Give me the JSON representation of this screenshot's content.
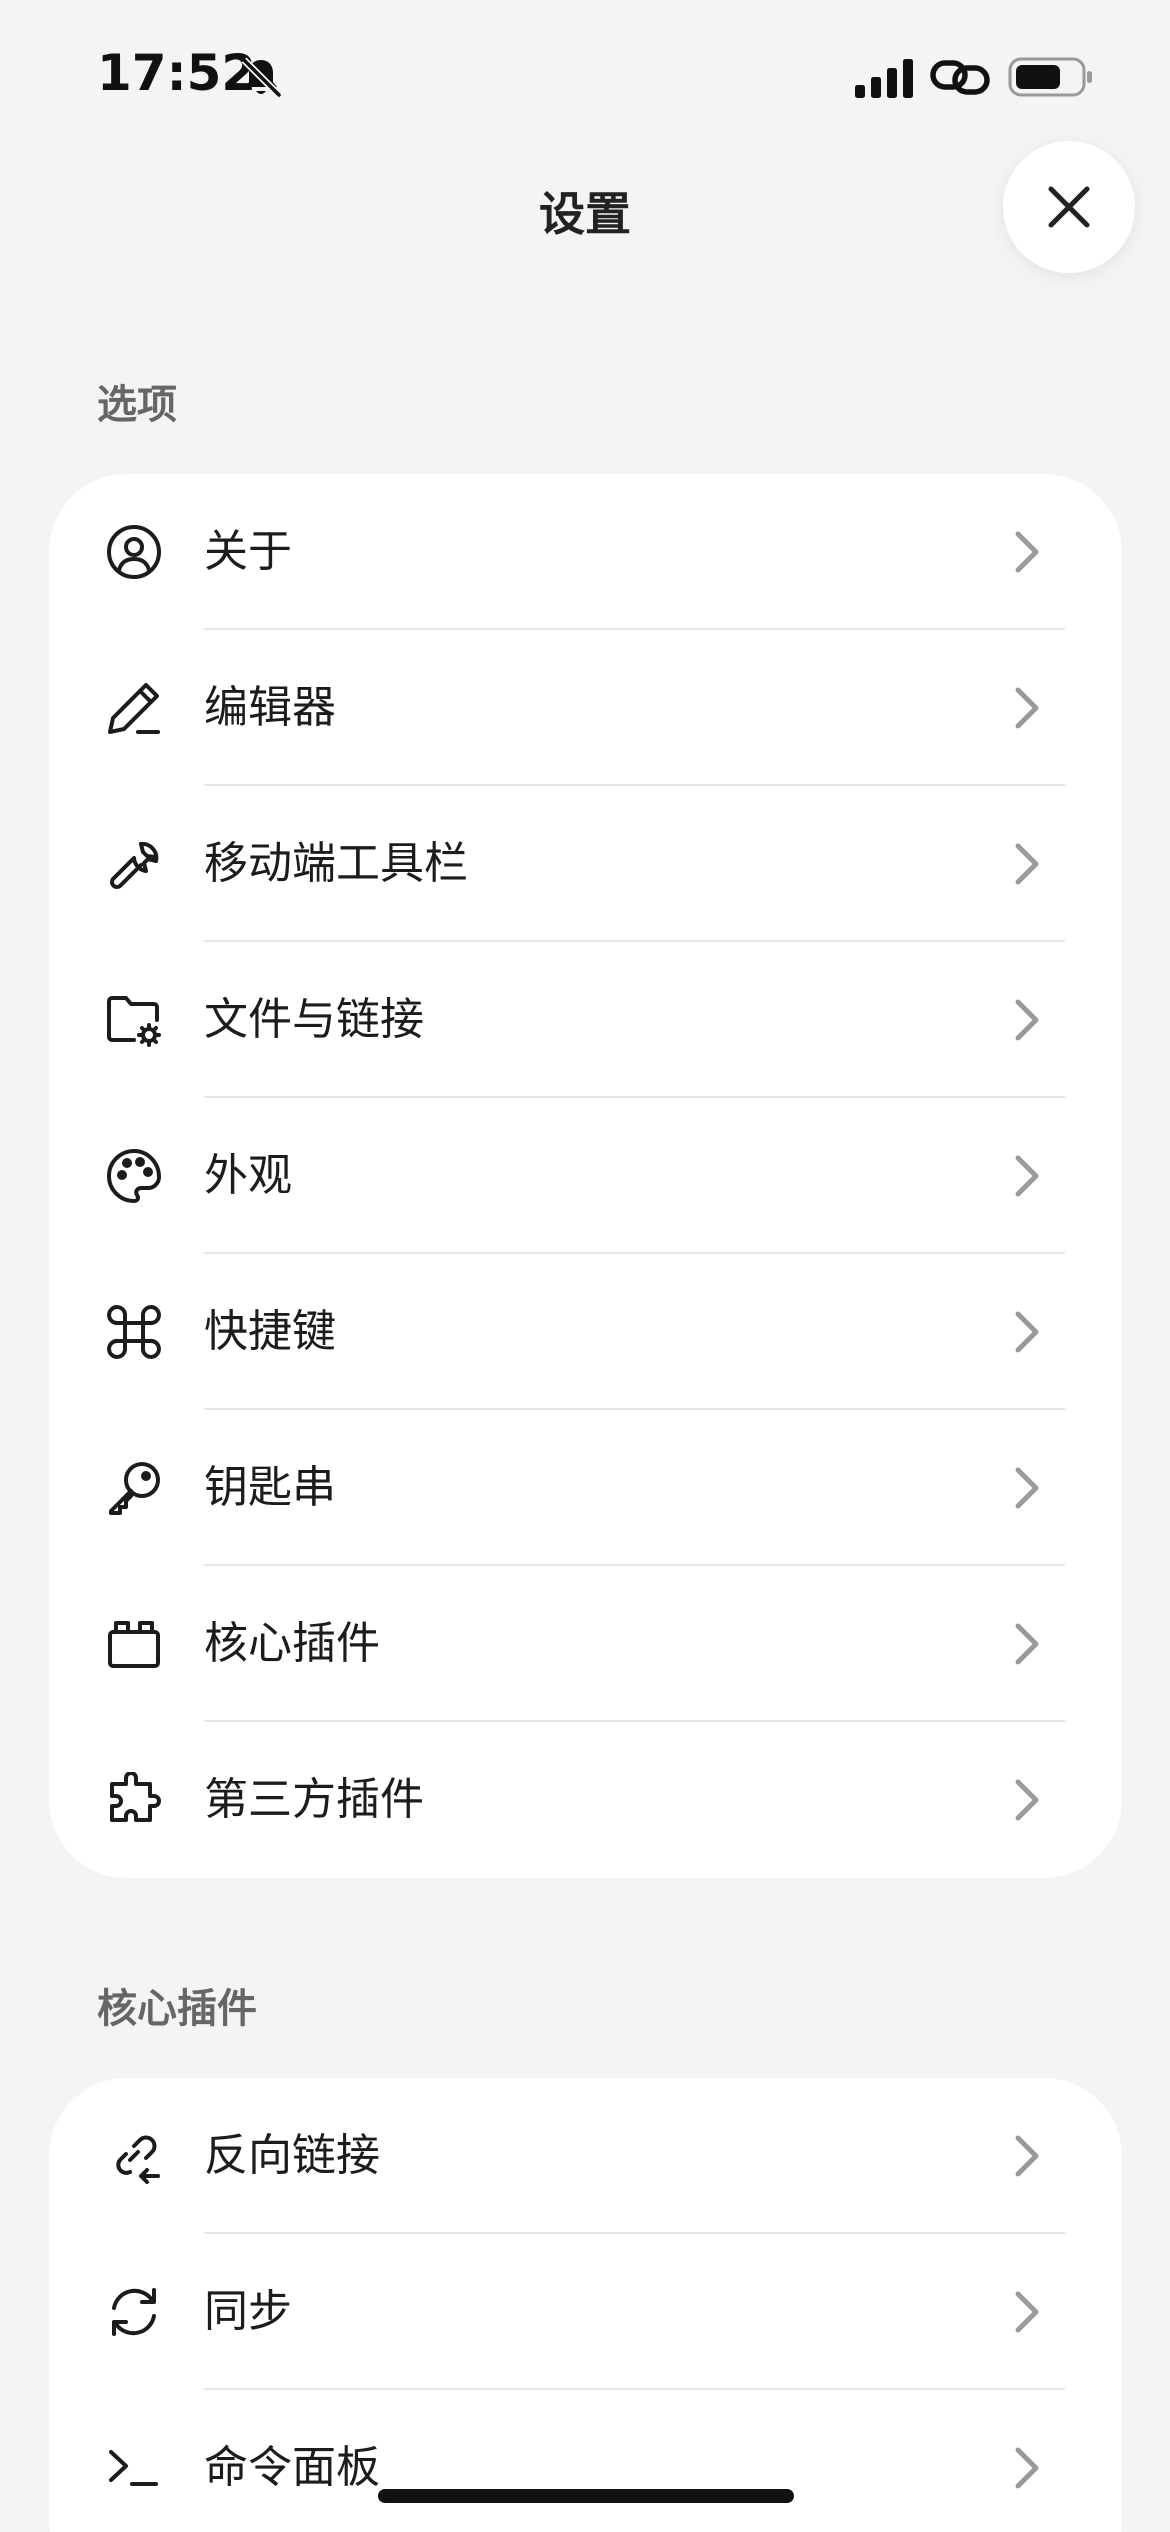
{
  "status_bar": {
    "time": "17:52"
  },
  "header": {
    "title": "设置"
  },
  "sections": {
    "options": {
      "label": "选项",
      "items": [
        {
          "label": "关于",
          "icon": "user-circle-icon"
        },
        {
          "label": "编辑器",
          "icon": "pencil-icon"
        },
        {
          "label": "移动端工具栏",
          "icon": "wrench-icon"
        },
        {
          "label": "文件与链接",
          "icon": "folder-gear-icon"
        },
        {
          "label": "外观",
          "icon": "palette-icon"
        },
        {
          "label": "快捷键",
          "icon": "command-icon"
        },
        {
          "label": "钥匙串",
          "icon": "key-icon"
        },
        {
          "label": "核心插件",
          "icon": "plugin-box-icon"
        },
        {
          "label": "第三方插件",
          "icon": "puzzle-icon"
        }
      ]
    },
    "core_plugins": {
      "label": "核心插件",
      "items": [
        {
          "label": "反向链接",
          "icon": "backlink-icon"
        },
        {
          "label": "同步",
          "icon": "sync-icon"
        },
        {
          "label": "命令面板",
          "icon": "terminal-icon"
        }
      ]
    }
  }
}
